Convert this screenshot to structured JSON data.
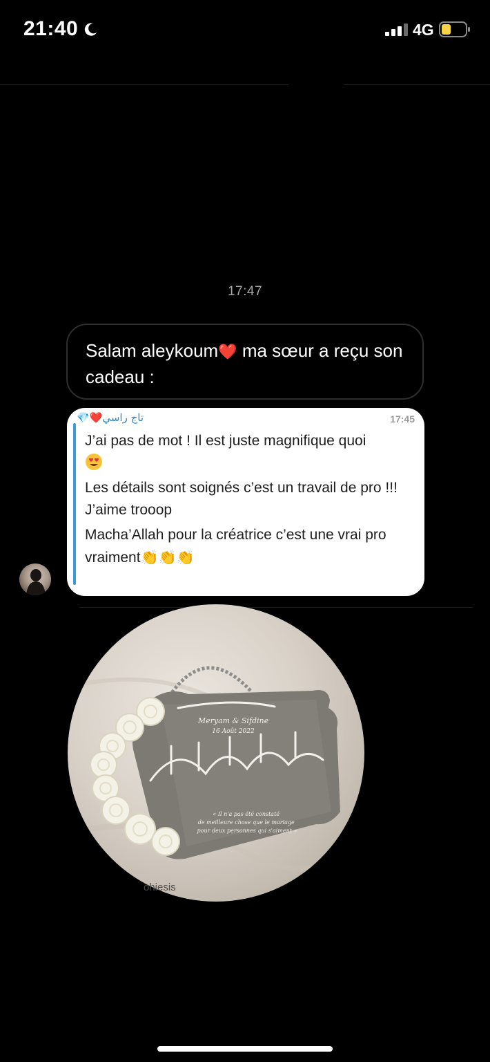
{
  "status_bar": {
    "time": "21:40",
    "network": "4G"
  },
  "chat": {
    "timestamp": "17:47",
    "message_text_part1": "Salam aleykoum",
    "message_heart": "❤️",
    "message_text_part2": " ma sœur a reçu son cadeau :"
  },
  "quoted_message": {
    "sender": "تاج راسي❤️💎",
    "time": "17:45",
    "line1": "J’ai pas de mot ! Il est juste magnifique quoi",
    "line2": "Les détails sont soignés c’est un travail de pro !!! J’aime trooop",
    "line3": "Macha’Allah pour la créatrice c’est une vrai pro vraiment",
    "line3_emojis": "👏👏👏"
  },
  "photo": {
    "plaque_names": "Meryam & Sifdine",
    "plaque_date": "16 Août 2022",
    "plaque_quote": "« Il n'a pas été constaté de meilleure chose que le mariage pour deux personnes qui s'aiment »",
    "watermark": "ohiesis"
  },
  "colors": {
    "background": "#000000",
    "quote_accent": "#3a9ad9",
    "heart": "#e0383a"
  }
}
